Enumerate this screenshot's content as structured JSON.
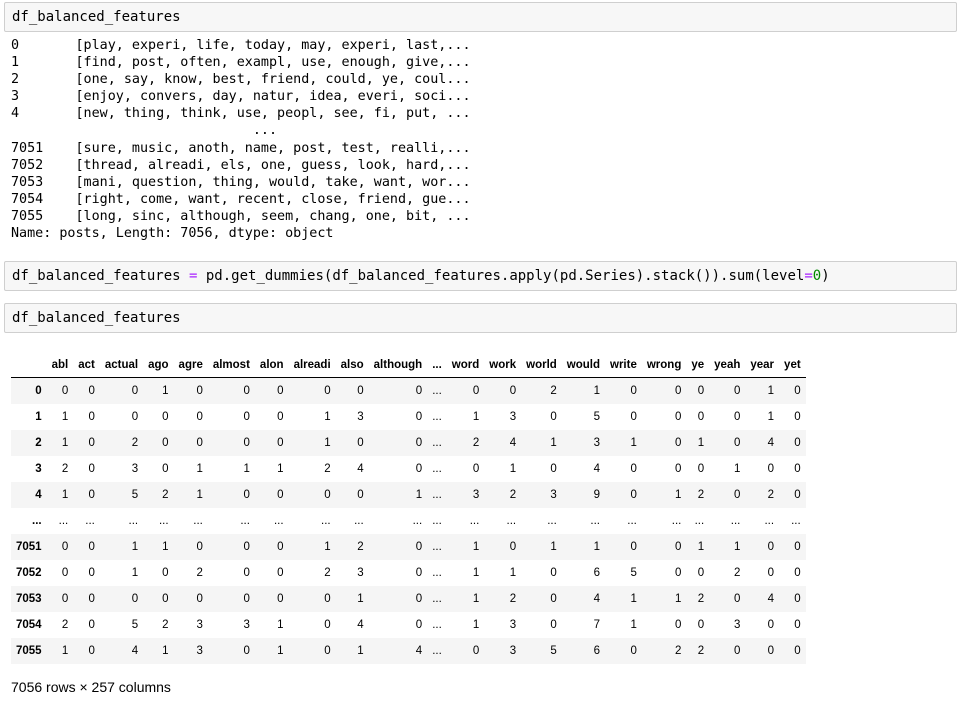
{
  "cells": {
    "cell1_code": "df_balanced_features",
    "cell3_code": "df_balanced_features"
  },
  "cell2": {
    "t1": "df_balanced_features ",
    "t2": "=",
    "t3": " pd.get_dummies(df_balanced_features.apply(pd.Series).stack()).sum(level",
    "t4": "=",
    "t5": "0",
    "t6": ")"
  },
  "series_output": {
    "lines": [
      "0       [play, experi, life, today, may, experi, last,...",
      "1       [find, post, often, exampl, use, enough, give,...",
      "2       [one, say, know, best, friend, could, ye, coul...",
      "3       [enjoy, convers, day, natur, idea, everi, soci...",
      "4       [new, thing, think, use, peopl, see, fi, put, ...",
      "                              ...",
      "7051    [sure, music, anoth, name, post, test, realli,...",
      "7052    [thread, alreadi, els, one, guess, look, hard,...",
      "7053    [mani, question, thing, would, take, want, wor...",
      "7054    [right, come, want, recent, close, friend, gue...",
      "7055    [long, sinc, although, seem, chang, one, bit, ...",
      "Name: posts, Length: 7056, dtype: object"
    ]
  },
  "dataframe": {
    "columns": [
      "abl",
      "act",
      "actual",
      "ago",
      "agre",
      "almost",
      "alon",
      "alreadi",
      "also",
      "although",
      "...",
      "word",
      "work",
      "world",
      "would",
      "write",
      "wrong",
      "ye",
      "yeah",
      "year",
      "yet"
    ],
    "rows": [
      {
        "index": "0",
        "values": [
          "0",
          "0",
          "0",
          "1",
          "0",
          "0",
          "0",
          "0",
          "0",
          "0",
          "...",
          "0",
          "0",
          "2",
          "1",
          "0",
          "0",
          "0",
          "0",
          "1",
          "0"
        ]
      },
      {
        "index": "1",
        "values": [
          "1",
          "0",
          "0",
          "0",
          "0",
          "0",
          "0",
          "1",
          "3",
          "0",
          "...",
          "1",
          "3",
          "0",
          "5",
          "0",
          "0",
          "0",
          "0",
          "1",
          "0"
        ]
      },
      {
        "index": "2",
        "values": [
          "1",
          "0",
          "2",
          "0",
          "0",
          "0",
          "0",
          "1",
          "0",
          "0",
          "...",
          "2",
          "4",
          "1",
          "3",
          "1",
          "0",
          "1",
          "0",
          "4",
          "0"
        ]
      },
      {
        "index": "3",
        "values": [
          "2",
          "0",
          "3",
          "0",
          "1",
          "1",
          "1",
          "2",
          "4",
          "0",
          "...",
          "0",
          "1",
          "0",
          "4",
          "0",
          "0",
          "0",
          "1",
          "0",
          "0"
        ]
      },
      {
        "index": "4",
        "values": [
          "1",
          "0",
          "5",
          "2",
          "1",
          "0",
          "0",
          "0",
          "0",
          "1",
          "...",
          "3",
          "2",
          "3",
          "9",
          "0",
          "1",
          "2",
          "0",
          "2",
          "0"
        ]
      },
      {
        "index": "...",
        "values": [
          "...",
          "...",
          "...",
          "...",
          "...",
          "...",
          "...",
          "...",
          "...",
          "...",
          "...",
          "...",
          "...",
          "...",
          "...",
          "...",
          "...",
          "...",
          "...",
          "...",
          "..."
        ]
      },
      {
        "index": "7051",
        "values": [
          "0",
          "0",
          "1",
          "1",
          "0",
          "0",
          "0",
          "1",
          "2",
          "0",
          "...",
          "1",
          "0",
          "1",
          "1",
          "0",
          "0",
          "1",
          "1",
          "0",
          "0"
        ]
      },
      {
        "index": "7052",
        "values": [
          "0",
          "0",
          "1",
          "0",
          "2",
          "0",
          "0",
          "2",
          "3",
          "0",
          "...",
          "1",
          "1",
          "0",
          "6",
          "5",
          "0",
          "0",
          "2",
          "0",
          "0"
        ]
      },
      {
        "index": "7053",
        "values": [
          "0",
          "0",
          "0",
          "0",
          "0",
          "0",
          "0",
          "0",
          "1",
          "0",
          "...",
          "1",
          "2",
          "0",
          "4",
          "1",
          "1",
          "2",
          "0",
          "4",
          "0"
        ]
      },
      {
        "index": "7054",
        "values": [
          "2",
          "0",
          "5",
          "2",
          "3",
          "3",
          "1",
          "0",
          "4",
          "0",
          "...",
          "1",
          "3",
          "0",
          "7",
          "1",
          "0",
          "0",
          "3",
          "0",
          "0"
        ]
      },
      {
        "index": "7055",
        "values": [
          "1",
          "0",
          "4",
          "1",
          "3",
          "0",
          "1",
          "0",
          "1",
          "4",
          "...",
          "0",
          "3",
          "5",
          "6",
          "0",
          "2",
          "2",
          "0",
          "0",
          "0"
        ]
      }
    ],
    "shape_text": "7056 rows × 257 columns"
  },
  "colors": {
    "cell_input_bg": "#f7f7f7",
    "operator": "#aa22ff",
    "number_literal": "#008800",
    "row_stripe": "#f5f5f5"
  }
}
